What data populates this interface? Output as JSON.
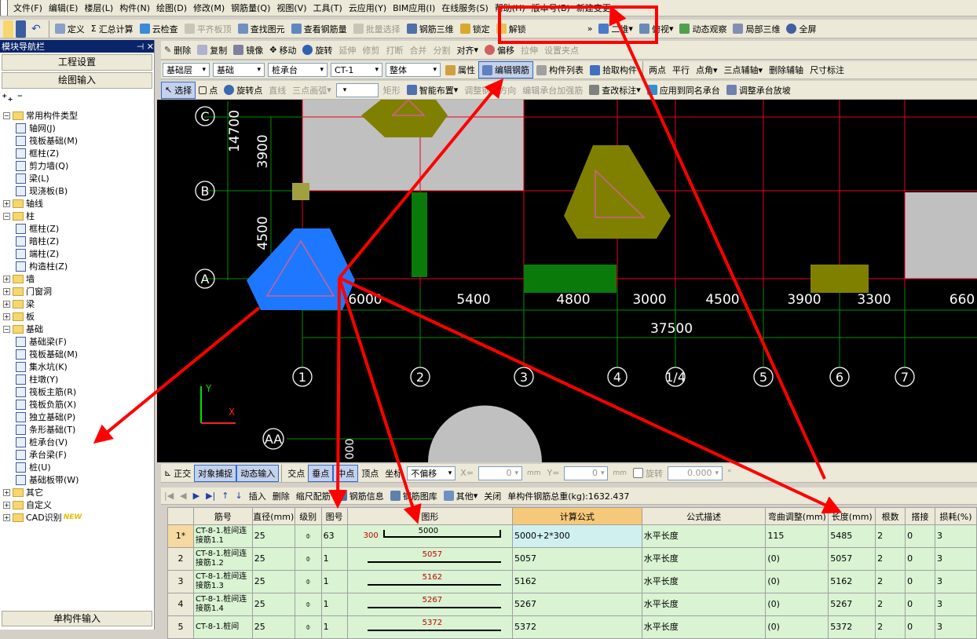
{
  "menu": [
    "文件(F)",
    "编辑(E)",
    "楼层(L)",
    "构件(N)",
    "绘图(D)",
    "修改(M)",
    "钢筋量(Q)",
    "视图(V)",
    "工具(T)",
    "云应用(Y)",
    "BIM应用(I)",
    "在线服务(S)",
    "帮助(H)",
    "版本号(B)",
    "新建变更"
  ],
  "toolbar1": {
    "items": [
      "定义",
      "汇总计算",
      "云检查",
      "平齐板顶",
      "查找图元",
      "查看钢筋量",
      "批量选择",
      "钢筋三维",
      "锁定",
      "解锁"
    ],
    "right": [
      "二维",
      "俯视",
      "动态观察",
      "局部三维",
      "全屏"
    ]
  },
  "toolbar2": {
    "items": [
      "删除",
      "复制",
      "镜像",
      "移动",
      "旋转",
      "延伸",
      "修剪",
      "打断",
      "合并",
      "分割",
      "对齐",
      "偏移",
      "拉伸",
      "设置夹点"
    ]
  },
  "toolbar3": {
    "floor": "基础层",
    "category": "基础",
    "type": "桩承台",
    "name": "CT-1",
    "whole": "整体",
    "items": [
      "属性",
      "编辑钢筋",
      "构件列表",
      "拾取构件",
      "两点",
      "平行",
      "点角",
      "三点辅轴",
      "删除辅轴",
      "尺寸标注"
    ]
  },
  "toolbar4": {
    "items": [
      "选择",
      "点",
      "旋转点",
      "直线",
      "三点画弧",
      "矩形",
      "智能布置",
      "调整钢筋方向",
      "编辑承台加强筋",
      "查改标注",
      "应用到同名承台",
      "调整承台放坡"
    ]
  },
  "nav": {
    "title": "模块导航栏",
    "buttons": [
      "工程设置",
      "绘图输入"
    ],
    "bottom": "单构件输入",
    "tree": [
      {
        "label": "常用构件类型",
        "level": 0,
        "type": "folder",
        "open": true
      },
      {
        "label": "轴网(J)",
        "level": 1,
        "type": "leaf"
      },
      {
        "label": "筏板基础(M)",
        "level": 1,
        "type": "leaf"
      },
      {
        "label": "框柱(Z)",
        "level": 1,
        "type": "leaf"
      },
      {
        "label": "剪力墙(Q)",
        "level": 1,
        "type": "leaf"
      },
      {
        "label": "梁(L)",
        "level": 1,
        "type": "leaf"
      },
      {
        "label": "现浇板(B)",
        "level": 1,
        "type": "leaf"
      },
      {
        "label": "轴线",
        "level": 0,
        "type": "folder",
        "open": false
      },
      {
        "label": "柱",
        "level": 0,
        "type": "folder",
        "open": true
      },
      {
        "label": "框柱(Z)",
        "level": 1,
        "type": "leaf"
      },
      {
        "label": "暗柱(Z)",
        "level": 1,
        "type": "leaf"
      },
      {
        "label": "端柱(Z)",
        "level": 1,
        "type": "leaf"
      },
      {
        "label": "构造柱(Z)",
        "level": 1,
        "type": "leaf"
      },
      {
        "label": "墙",
        "level": 0,
        "type": "folder",
        "open": false
      },
      {
        "label": "门窗洞",
        "level": 0,
        "type": "folder",
        "open": false
      },
      {
        "label": "梁",
        "level": 0,
        "type": "folder",
        "open": false
      },
      {
        "label": "板",
        "level": 0,
        "type": "folder",
        "open": false
      },
      {
        "label": "基础",
        "level": 0,
        "type": "folder",
        "open": true
      },
      {
        "label": "基础梁(F)",
        "level": 1,
        "type": "leaf"
      },
      {
        "label": "筏板基础(M)",
        "level": 1,
        "type": "leaf"
      },
      {
        "label": "集水坑(K)",
        "level": 1,
        "type": "leaf"
      },
      {
        "label": "柱墩(Y)",
        "level": 1,
        "type": "leaf"
      },
      {
        "label": "筏板主筋(R)",
        "level": 1,
        "type": "leaf"
      },
      {
        "label": "筏板负筋(X)",
        "level": 1,
        "type": "leaf"
      },
      {
        "label": "独立基础(P)",
        "level": 1,
        "type": "leaf"
      },
      {
        "label": "条形基础(T)",
        "level": 1,
        "type": "leaf"
      },
      {
        "label": "桩承台(V)",
        "level": 1,
        "type": "leaf"
      },
      {
        "label": "承台梁(F)",
        "level": 1,
        "type": "leaf"
      },
      {
        "label": "桩(U)",
        "level": 1,
        "type": "leaf"
      },
      {
        "label": "基础板带(W)",
        "level": 1,
        "type": "leaf"
      },
      {
        "label": "其它",
        "level": 0,
        "type": "folder",
        "open": false
      },
      {
        "label": "自定义",
        "level": 0,
        "type": "folder",
        "open": false
      },
      {
        "label": "CAD识别",
        "level": 0,
        "type": "folder",
        "open": false,
        "badge": "NEW"
      }
    ]
  },
  "canvas": {
    "axes_v": [
      "1",
      "2",
      "3",
      "4",
      "1/4",
      "5",
      "6",
      "7"
    ],
    "axes_h": [
      "C",
      "B",
      "A"
    ],
    "dims_bottom": [
      "6000",
      "5400",
      "4800",
      "3000",
      "4500",
      "3900",
      "3300",
      "660"
    ],
    "dim_total": "37500",
    "dims_left": [
      "14700",
      "3900",
      "4500"
    ],
    "axis_aa": "AA",
    "dim_aa": "000",
    "ucs_y": "Y",
    "ucs_x": "X"
  },
  "statusbar": {
    "items": [
      "正交",
      "对象捕捉",
      "动态输入",
      "交点",
      "垂点",
      "中点",
      "顶点",
      "坐标"
    ],
    "offset": "不偏移",
    "x_label": "X=",
    "x_val": "0",
    "y_label": "Y=",
    "y_val": "0",
    "mm": "mm",
    "rotate": "旋转",
    "rot_val": "0.000",
    "deg": "°"
  },
  "rebar_toolbar": {
    "items": [
      "插入",
      "删除",
      "缩尺配筋",
      "钢筋信息",
      "钢筋图库",
      "其他",
      "关闭"
    ],
    "total": "单构件钢筋总重(kg):1632.437"
  },
  "table": {
    "headers": [
      "筋号",
      "直径(mm)",
      "级别",
      "图号",
      "图形",
      "计算公式",
      "公式描述",
      "弯曲调整(mm)",
      "长度(mm)",
      "根数",
      "搭接",
      "损耗(%)"
    ],
    "rows": [
      {
        "idx": "1*",
        "name": "CT-8-1.桩间连接筋1.1",
        "dia": "25",
        "grade": "⌽",
        "fig": "63",
        "shape_left": "300",
        "shape_val": "5000",
        "formula": "5000+2*300",
        "desc": "水平长度",
        "bend": "115",
        "len": "5485",
        "count": "2",
        "lap": "0",
        "loss": "3"
      },
      {
        "idx": "2",
        "name": "CT-8-1.桩间连接筋1.2",
        "dia": "25",
        "grade": "⌽",
        "fig": "1",
        "shape_left": "",
        "shape_val": "5057",
        "formula": "5057",
        "desc": "水平长度",
        "bend": "(0)",
        "len": "5057",
        "count": "2",
        "lap": "0",
        "loss": "3"
      },
      {
        "idx": "3",
        "name": "CT-8-1.桩间连接筋1.3",
        "dia": "25",
        "grade": "⌽",
        "fig": "1",
        "shape_left": "",
        "shape_val": "5162",
        "formula": "5162",
        "desc": "水平长度",
        "bend": "(0)",
        "len": "5162",
        "count": "2",
        "lap": "0",
        "loss": "3"
      },
      {
        "idx": "4",
        "name": "CT-8-1.桩间连接筋1.4",
        "dia": "25",
        "grade": "⌽",
        "fig": "1",
        "shape_left": "",
        "shape_val": "5267",
        "formula": "5267",
        "desc": "水平长度",
        "bend": "(0)",
        "len": "5267",
        "count": "2",
        "lap": "0",
        "loss": "3"
      },
      {
        "idx": "5",
        "name": "CT-8-1.桩间",
        "dia": "25",
        "grade": "⌽",
        "fig": "1",
        "shape_left": "",
        "shape_val": "5372",
        "formula": "5372",
        "desc": "水平长度",
        "bend": "(0)",
        "len": "5372",
        "count": "2",
        "lap": "0",
        "loss": "3"
      }
    ]
  },
  "colors": {
    "annotation": "#ff0000",
    "canvas_bg": "#000000",
    "grid": "#e8001e",
    "dim": "#00c000",
    "cap_olive": "#808000",
    "selected_cap": "#1e78ff"
  }
}
